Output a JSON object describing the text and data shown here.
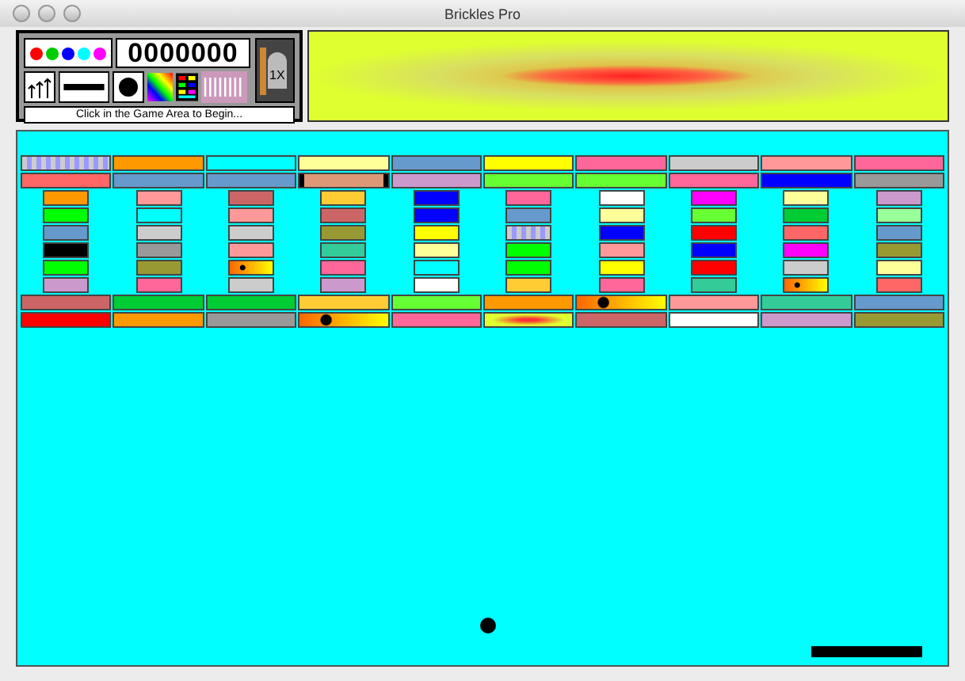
{
  "window": {
    "title": "Brickles Pro"
  },
  "control_panel": {
    "color_dots": [
      {
        "color": "#ff0000"
      },
      {
        "color": "#00cc00"
      },
      {
        "color": "#0000ff"
      },
      {
        "color": "#00ffff"
      },
      {
        "color": "#ff00ff"
      }
    ],
    "score": "0000000",
    "multiplier": "1X",
    "status": "Click in the Game Area to Begin..."
  },
  "wide_brick_rows_top": [
    [
      {
        "kind": "bowtie"
      },
      {
        "kind": "plain",
        "color": "#ff9900"
      },
      {
        "kind": "plain",
        "color": "#00ffff"
      },
      {
        "kind": "plain",
        "color": "#ffff99"
      },
      {
        "kind": "plain",
        "color": "#6699cc"
      },
      {
        "kind": "plain",
        "color": "#ffff00"
      },
      {
        "kind": "plain",
        "color": "#ff6699"
      },
      {
        "kind": "plain",
        "color": "#cccccc"
      },
      {
        "kind": "plain",
        "color": "#ff9999"
      },
      {
        "kind": "plain",
        "color": "#ff6699"
      }
    ],
    [
      {
        "kind": "plain",
        "color": "#ff6666"
      },
      {
        "kind": "plain",
        "color": "#6699cc"
      },
      {
        "kind": "plain",
        "color": "#6699cc"
      },
      {
        "kind": "wood"
      },
      {
        "kind": "plain",
        "color": "#cc99cc"
      },
      {
        "kind": "plain",
        "color": "#66ff33"
      },
      {
        "kind": "plain",
        "color": "#66ff33"
      },
      {
        "kind": "plain",
        "color": "#ff6699"
      },
      {
        "kind": "plain",
        "color": "#0000ff"
      },
      {
        "kind": "plain",
        "color": "#999999"
      }
    ]
  ],
  "small_brick_rows": [
    [
      {
        "kind": "plain",
        "color": "#ff9900"
      },
      {
        "kind": "plain",
        "color": "#ff9999"
      },
      {
        "kind": "plain",
        "color": "#cc6666"
      },
      {
        "kind": "plain",
        "color": "#ffcc33"
      },
      {
        "kind": "plain",
        "color": "#0000ff"
      },
      {
        "kind": "plain",
        "color": "#ff6699"
      },
      {
        "kind": "plain",
        "color": "#ffffff"
      },
      {
        "kind": "plain",
        "color": "#ff00ff"
      },
      {
        "kind": "plain",
        "color": "#ffff99"
      },
      {
        "kind": "plain",
        "color": "#cc99cc"
      }
    ],
    [
      {
        "kind": "plain",
        "color": "#00ff00"
      },
      {
        "kind": "plain",
        "color": "#00ffff"
      },
      {
        "kind": "plain",
        "color": "#ff9999"
      },
      {
        "kind": "plain",
        "color": "#cc6666"
      },
      {
        "kind": "plain",
        "color": "#0000ff"
      },
      {
        "kind": "plain",
        "color": "#6699cc"
      },
      {
        "kind": "plain",
        "color": "#ffff99"
      },
      {
        "kind": "plain",
        "color": "#66ff33"
      },
      {
        "kind": "plain",
        "color": "#00cc33"
      },
      {
        "kind": "plain",
        "color": "#99ff99"
      }
    ],
    [
      {
        "kind": "plain",
        "color": "#6699cc"
      },
      {
        "kind": "plain",
        "color": "#cccccc"
      },
      {
        "kind": "plain",
        "color": "#cccccc"
      },
      {
        "kind": "plain",
        "color": "#999933"
      },
      {
        "kind": "plain",
        "color": "#ffff00"
      },
      {
        "kind": "bowtie"
      },
      {
        "kind": "plain",
        "color": "#0000ff"
      },
      {
        "kind": "plain",
        "color": "#ff0000"
      },
      {
        "kind": "plain",
        "color": "#ff6666"
      },
      {
        "kind": "plain",
        "color": "#6699cc"
      }
    ],
    [
      {
        "kind": "plain",
        "color": "#000000"
      },
      {
        "kind": "plain",
        "color": "#999999"
      },
      {
        "kind": "plain",
        "color": "#ff9999"
      },
      {
        "kind": "plain",
        "color": "#33cc99"
      },
      {
        "kind": "plain",
        "color": "#ffff99"
      },
      {
        "kind": "plain",
        "color": "#00ff00"
      },
      {
        "kind": "plain",
        "color": "#ff9999"
      },
      {
        "kind": "plain",
        "color": "#0000ff"
      },
      {
        "kind": "plain",
        "color": "#ff00ff"
      },
      {
        "kind": "plain",
        "color": "#999933"
      }
    ],
    [
      {
        "kind": "plain",
        "color": "#00ff00"
      },
      {
        "kind": "plain",
        "color": "#999933"
      },
      {
        "kind": "stars"
      },
      {
        "kind": "plain",
        "color": "#ff6699"
      },
      {
        "kind": "plain",
        "color": "#00ffff"
      },
      {
        "kind": "plain",
        "color": "#00ff00"
      },
      {
        "kind": "plain",
        "color": "#ffff00"
      },
      {
        "kind": "plain",
        "color": "#ff0000"
      },
      {
        "kind": "plain",
        "color": "#cccccc"
      },
      {
        "kind": "plain",
        "color": "#ffff99"
      }
    ],
    [
      {
        "kind": "plain",
        "color": "#cc99cc"
      },
      {
        "kind": "plain",
        "color": "#ff6699"
      },
      {
        "kind": "plain",
        "color": "#cccccc"
      },
      {
        "kind": "plain",
        "color": "#cc99cc"
      },
      {
        "kind": "plain",
        "color": "#ffffff"
      },
      {
        "kind": "plain",
        "color": "#ffcc33"
      },
      {
        "kind": "plain",
        "color": "#ff6699"
      },
      {
        "kind": "plain",
        "color": "#33cc99"
      },
      {
        "kind": "stars"
      },
      {
        "kind": "plain",
        "color": "#ff6666"
      }
    ]
  ],
  "wide_brick_rows_bottom": [
    [
      {
        "kind": "plain",
        "color": "#cc6666"
      },
      {
        "kind": "plain",
        "color": "#00cc33"
      },
      {
        "kind": "plain",
        "color": "#00cc33"
      },
      {
        "kind": "plain",
        "color": "#ffcc33"
      },
      {
        "kind": "plain",
        "color": "#66ff33"
      },
      {
        "kind": "plain",
        "color": "#ff9900"
      },
      {
        "kind": "stars"
      },
      {
        "kind": "plain",
        "color": "#ff9999"
      },
      {
        "kind": "plain",
        "color": "#33cc99"
      },
      {
        "kind": "plain",
        "color": "#6699cc"
      }
    ],
    [
      {
        "kind": "plain",
        "color": "#ff0000"
      },
      {
        "kind": "plain",
        "color": "#ff9900"
      },
      {
        "kind": "plain",
        "color": "#999999"
      },
      {
        "kind": "stars"
      },
      {
        "kind": "plain",
        "color": "#ff6699"
      },
      {
        "kind": "gradient"
      },
      {
        "kind": "plain",
        "color": "#cc6666"
      },
      {
        "kind": "plain",
        "color": "#ffffff"
      },
      {
        "kind": "plain",
        "color": "#cc99cc"
      },
      {
        "kind": "plain",
        "color": "#999933"
      }
    ]
  ]
}
